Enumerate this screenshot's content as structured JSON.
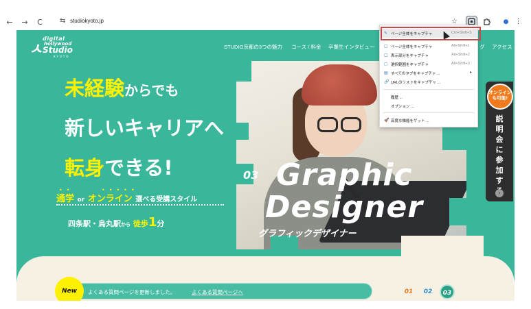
{
  "browser": {
    "url": "studiokyoto.jp",
    "back_glyph": "←",
    "forward_glyph": "→",
    "reload_glyph": "C",
    "site_info_glyph": "⇆",
    "star_glyph": "☆",
    "more_glyph": "⋮",
    "profile_glyph": "●"
  },
  "logo": {
    "line1": "digital",
    "line2": "hollywood",
    "line3": "Studio",
    "line4": "KYOTO"
  },
  "nav": {
    "items": [
      "STUDIO京都の3つの魅力",
      "コース / 料金",
      "卒業生インタビュー",
      "グ",
      "アクセス"
    ]
  },
  "hero": {
    "line1_accent": "未経験",
    "line1_rest": "からでも",
    "line2": "新しいキャリアへ",
    "line3_accent": "転身",
    "line3_rest": "できる!",
    "sub_a": "通学",
    "sub_or": "or",
    "sub_b": "オンライン",
    "sub_rest": "選べる受講スタイル",
    "access_a": "四条駅・烏丸駅",
    "access_from": "から",
    "access_walk": "徒歩",
    "access_num": "1",
    "access_unit": "分"
  },
  "feature": {
    "number": "03",
    "title1": "Graphic",
    "title2": "Designer",
    "kana": "グラフィックデザイナー"
  },
  "side_tab": {
    "bubble": "オンライン も可能!",
    "text": [
      "説",
      "明",
      "会",
      "に",
      "参",
      "加",
      "す",
      "る"
    ],
    "arrow": "›"
  },
  "news": {
    "badge": "New",
    "text": "よくある質問ページを更新しました。",
    "link": "よくある質問ページへ"
  },
  "pager": [
    "01",
    "02",
    "03"
  ],
  "menu": {
    "items": [
      {
        "icon": "✎",
        "label": "ページ全体をキャプチャ",
        "shortcut": "Ctrl+Shift+S"
      },
      {
        "icon": "▢",
        "label": "ページ全体をキャプチャ",
        "shortcut": "Alt+Shift+1"
      },
      {
        "icon": "▢",
        "label": "表示部分をキャプチャ",
        "shortcut": "Alt+Shift+2"
      },
      {
        "icon": "◻",
        "label": "選択範囲をキャプチャ",
        "shortcut": "Alt+Shift+3"
      },
      {
        "icon": "▤",
        "label": "すべてのタブをキャプチャ ...",
        "shortcut": ""
      },
      {
        "icon": "🔗",
        "label": "URLのリストをキャプチャ ...",
        "shortcut": ""
      },
      {
        "icon": "",
        "label": "履歴 ...",
        "shortcut": ""
      },
      {
        "icon": "",
        "label": "オプション ...",
        "shortcut": ""
      },
      {
        "icon": "🚀",
        "label": "高度な機能をゲット ...",
        "shortcut": ""
      }
    ],
    "submenu_arrow": "▸"
  },
  "colors": {
    "brand_green": "#3ab79b",
    "accent_yellow": "#fff200",
    "accent_orange": "#f07b1e",
    "highlight_red": "#c9494b"
  }
}
